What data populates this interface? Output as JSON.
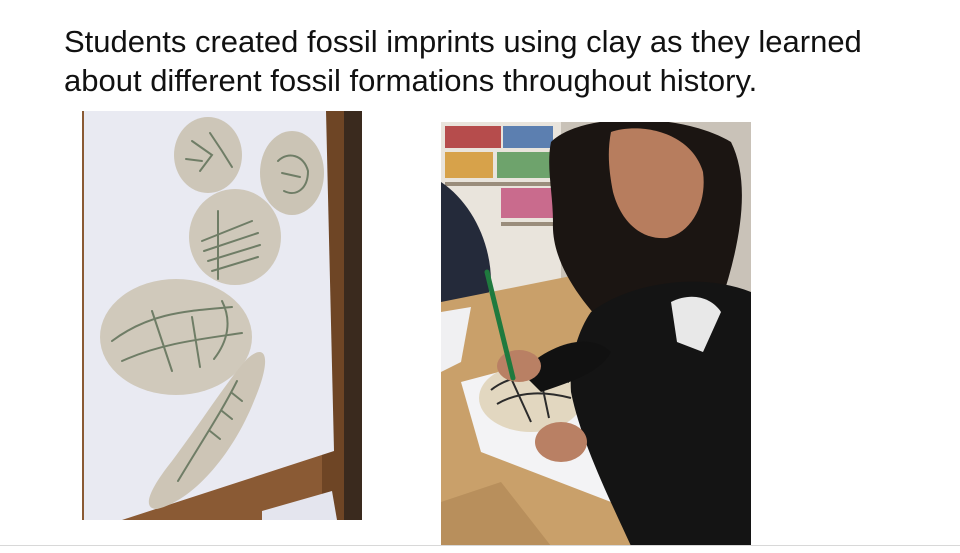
{
  "slide": {
    "caption_line1": "Students created fossil imprints using clay as they learned",
    "caption_line2": "about different fossil formations throughout history."
  }
}
